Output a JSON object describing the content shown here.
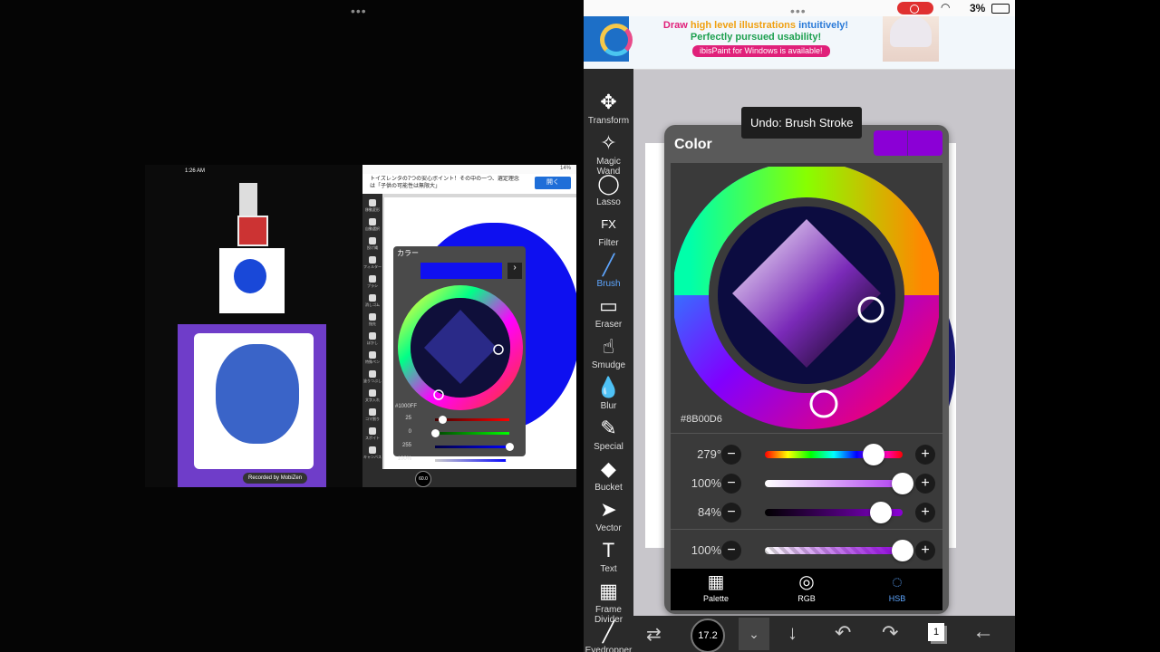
{
  "left": {
    "top_dots": "•••",
    "rec_phone": {
      "time": "1:26 AM",
      "recorded_by": "Recorded by",
      "recorder_brand": "MobiZen"
    },
    "mini_ibis": {
      "ad_text": "トイズレンタの7つの安心ポイント！その中の一つ、選定理念は「子供の可能性は無限大」",
      "ad_button": "開く",
      "battery": "14%",
      "panel_title": "カラー",
      "hex": "#1000FF",
      "sliders": [
        "25",
        "0",
        "255",
        "100%"
      ],
      "tools": [
        "移動変形",
        "自動選択",
        "投げ縄",
        "フィルター",
        "ブラシ",
        "消しゴム",
        "指先",
        "ぼかし",
        "特殊ペン",
        "塗りつぶし",
        "文字入れ",
        "コマ割り",
        "スポイト",
        "キャンバス"
      ],
      "brush_size": "60.0"
    }
  },
  "status": {
    "battery": "3%"
  },
  "ad": {
    "headline_part1": "Draw",
    "headline_part2": "high level illustrations",
    "headline_part3": "intuitively!",
    "headline_part4": "Perfectly pursued usability!",
    "pill": "ibisPaint for Windows is available!",
    "window_dots": "•••"
  },
  "toolbar": {
    "tools": [
      {
        "name": "transform",
        "label": "Transform"
      },
      {
        "name": "magic-wand",
        "label": "Magic Wand"
      },
      {
        "name": "lasso",
        "label": "Lasso"
      },
      {
        "name": "filter",
        "label": "Filter"
      },
      {
        "name": "brush",
        "label": "Brush"
      },
      {
        "name": "eraser",
        "label": "Eraser"
      },
      {
        "name": "smudge",
        "label": "Smudge"
      },
      {
        "name": "blur",
        "label": "Blur"
      },
      {
        "name": "special",
        "label": "Special"
      },
      {
        "name": "bucket",
        "label": "Bucket"
      },
      {
        "name": "vector",
        "label": "Vector"
      },
      {
        "name": "text",
        "label": "Text"
      },
      {
        "name": "frame-divider",
        "label": "Frame Divider"
      },
      {
        "name": "eyedropper",
        "label": "Eyedropper"
      }
    ],
    "active": "Brush"
  },
  "tooltip": "Undo: Brush Stroke",
  "color_panel": {
    "title": "Color",
    "current_color": "#8B00D6",
    "hex_label": "#8B00D6",
    "sliders": [
      {
        "name": "hue",
        "value": "279°",
        "fraction": 0.79
      },
      {
        "name": "saturation",
        "value": "100%",
        "fraction": 1.0
      },
      {
        "name": "brightness",
        "value": "84%",
        "fraction": 0.84
      },
      {
        "name": "opacity",
        "value": "100%",
        "fraction": 1.0
      }
    ],
    "tabs": [
      {
        "name": "palette",
        "label": "Palette"
      },
      {
        "name": "rgb",
        "label": "RGB"
      },
      {
        "name": "hsb",
        "label": "HSB"
      }
    ],
    "active_tab": "HSB",
    "minus": "−",
    "plus": "+"
  },
  "bottom_bar": {
    "brush_size": "17.2"
  }
}
